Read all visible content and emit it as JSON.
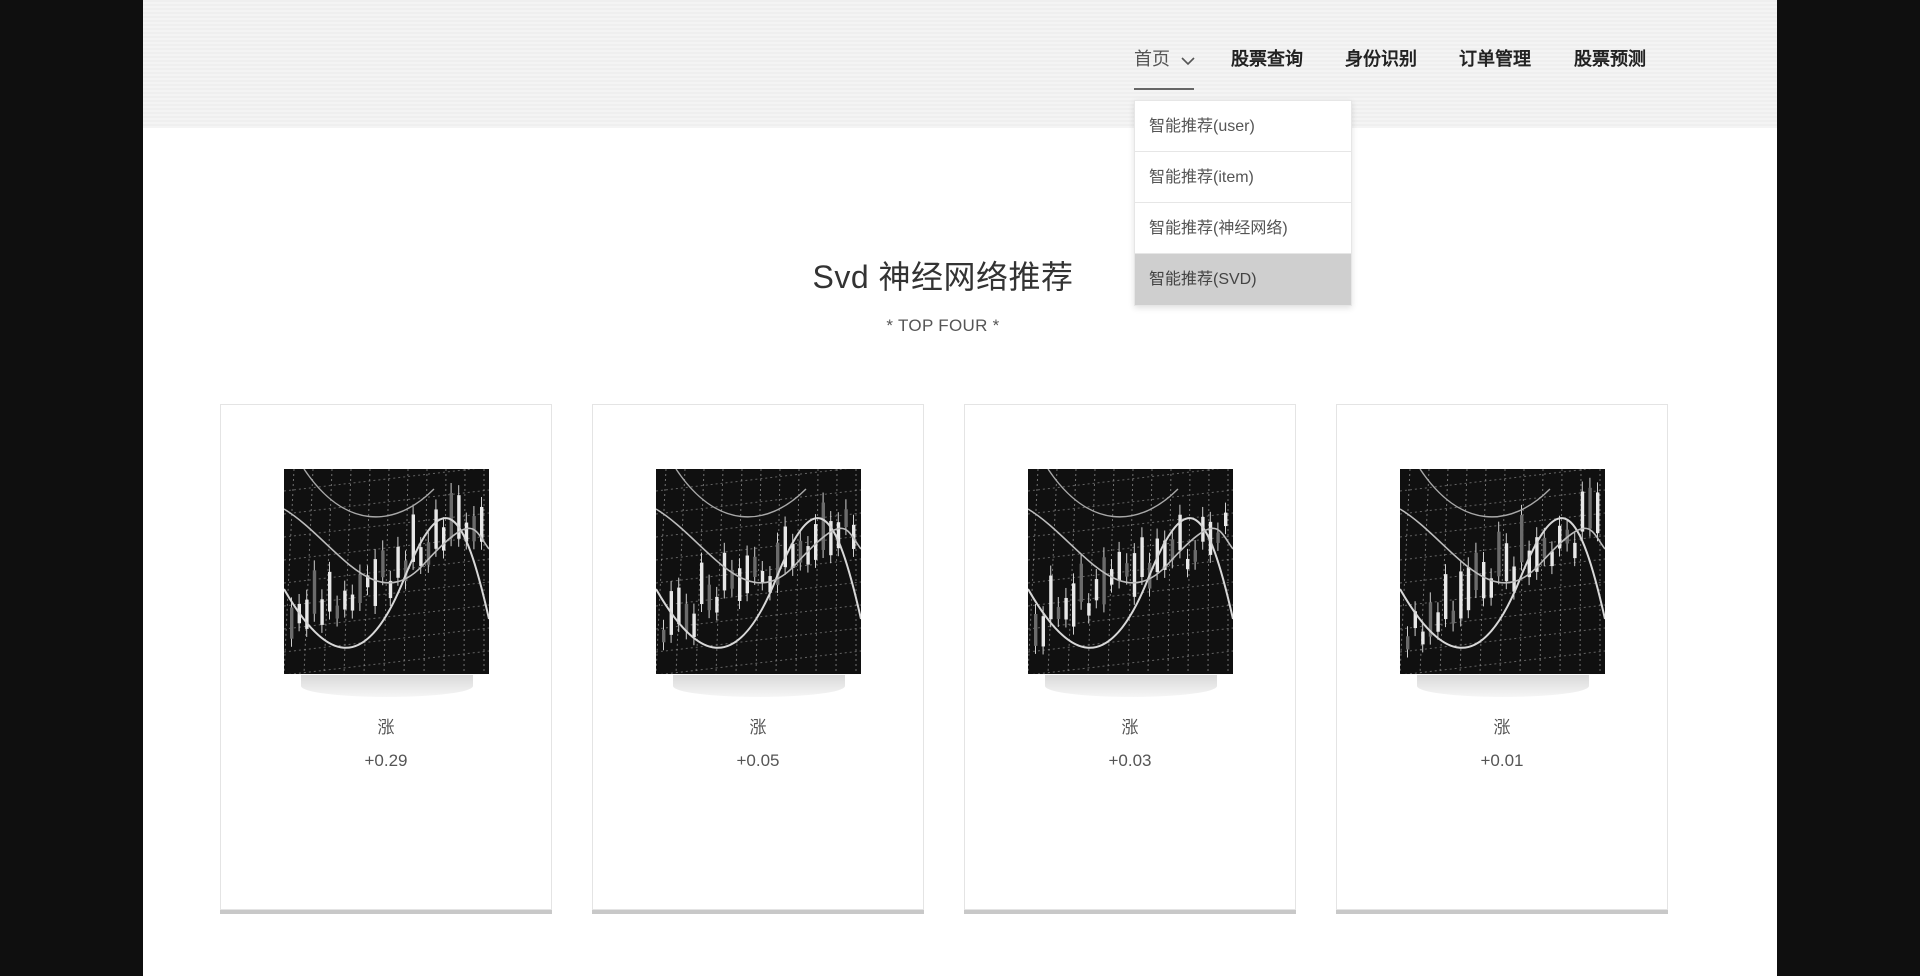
{
  "nav": {
    "items": [
      {
        "label": "首页"
      },
      {
        "label": "股票查询"
      },
      {
        "label": "身份识别"
      },
      {
        "label": "订单管理"
      },
      {
        "label": "股票预测"
      }
    ],
    "dropdown": [
      {
        "label": "智能推荐(user)"
      },
      {
        "label": "智能推荐(item)"
      },
      {
        "label": "智能推荐(神经网络)"
      },
      {
        "label": "智能推荐(SVD)"
      }
    ]
  },
  "main": {
    "title": "Svd 神经网络推荐",
    "subtitle": "* TOP FOUR *"
  },
  "cards": [
    {
      "label": "涨",
      "value": "+0.29"
    },
    {
      "label": "涨",
      "value": "+0.05"
    },
    {
      "label": "涨",
      "value": "+0.03"
    },
    {
      "label": "涨",
      "value": "+0.01"
    }
  ],
  "colors": {
    "thumb_bg": "#101010",
    "selected_bg": "#cfcfcf"
  }
}
